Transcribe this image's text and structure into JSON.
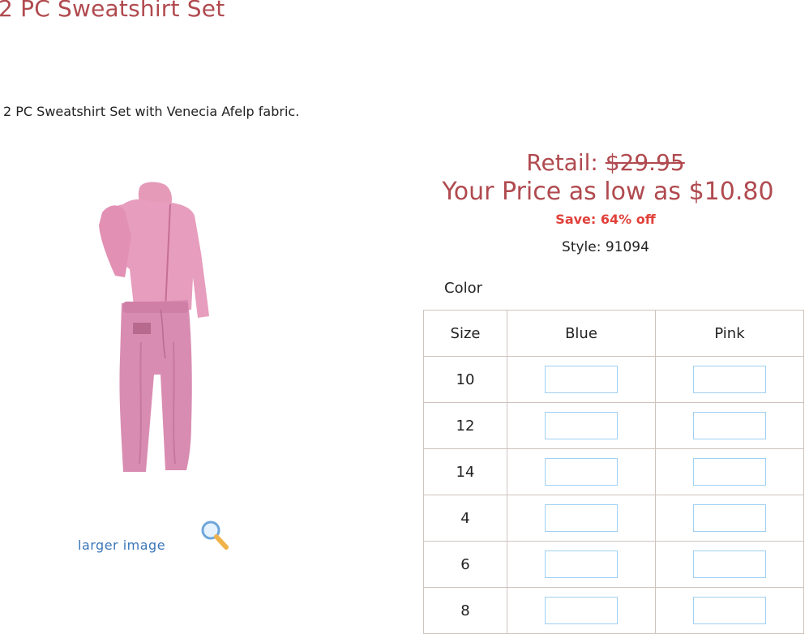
{
  "product": {
    "title": "2 PC Sweatshirt Set",
    "description": "2 PC Sweatshirt Set with Venecia Afelp fabric.",
    "larger_image_label": "larger image",
    "image_icon": "pink-sweatsuit-image"
  },
  "pricing": {
    "retail_label": "Retail: ",
    "retail_price": "$29.95",
    "your_price": "Your Price as low as $10.80",
    "save": "Save: 64% off",
    "style": "Style: 91094"
  },
  "order_grid": {
    "color_label": "Color",
    "size_header": "Size",
    "colors": [
      "Blue",
      "Pink"
    ],
    "sizes": [
      "10",
      "12",
      "14",
      "4",
      "6",
      "8"
    ]
  },
  "colors": {
    "title": "#b04a4f",
    "save": "#e0413a",
    "link": "#3b77b9",
    "input_border": "#9fd0f2"
  }
}
